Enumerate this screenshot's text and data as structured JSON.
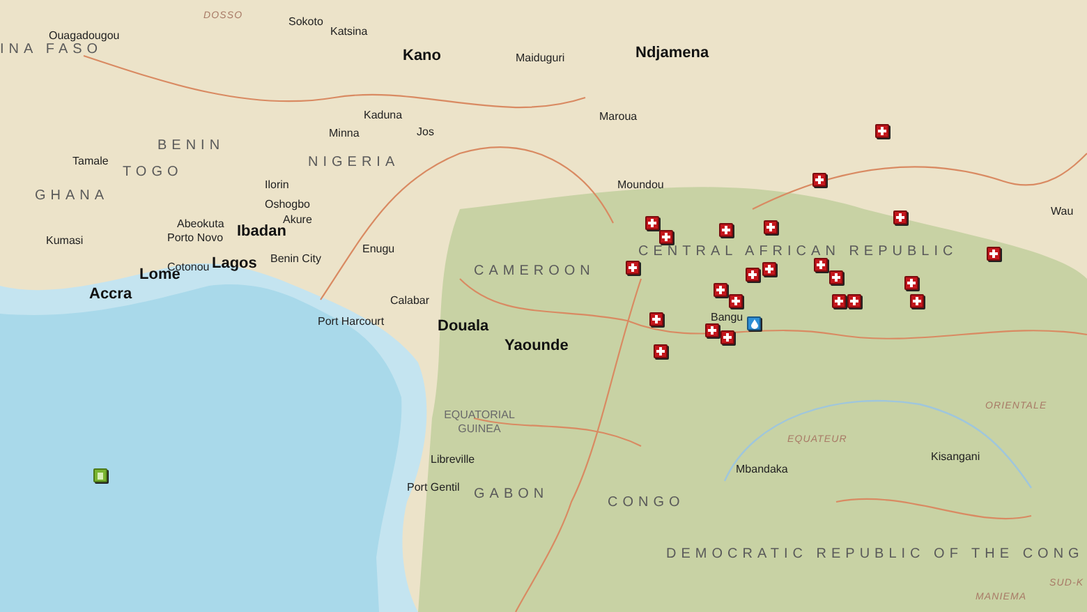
{
  "labels": [
    {
      "text": "Ouagadougou",
      "kind": "city"
    },
    {
      "text": "INA FASO",
      "kind": "country"
    },
    {
      "text": "DOSSO",
      "kind": "region"
    },
    {
      "text": "Sokoto",
      "kind": "city"
    },
    {
      "text": "Katsina",
      "kind": "city"
    },
    {
      "text": "Kano",
      "kind": "major"
    },
    {
      "text": "Maiduguri",
      "kind": "city"
    },
    {
      "text": "Ndjamena",
      "kind": "major"
    },
    {
      "text": "Maroua",
      "kind": "city"
    },
    {
      "text": "Kaduna",
      "kind": "city"
    },
    {
      "text": "Minna",
      "kind": "city"
    },
    {
      "text": "Jos",
      "kind": "city"
    },
    {
      "text": "BENIN",
      "kind": "country"
    },
    {
      "text": "NIGERIA",
      "kind": "country"
    },
    {
      "text": "Tamale",
      "kind": "city"
    },
    {
      "text": "TOGO",
      "kind": "country"
    },
    {
      "text": "GHANA",
      "kind": "country"
    },
    {
      "text": "Moundou",
      "kind": "city"
    },
    {
      "text": "Ilorin",
      "kind": "city"
    },
    {
      "text": "Oshogbo",
      "kind": "city"
    },
    {
      "text": "Abeokuta",
      "kind": "city"
    },
    {
      "text": "Ibadan",
      "kind": "major"
    },
    {
      "text": "Akure",
      "kind": "city"
    },
    {
      "text": "Wau",
      "kind": "city"
    },
    {
      "text": "Porto Novo",
      "kind": "city"
    },
    {
      "text": "Kumasi",
      "kind": "city"
    },
    {
      "text": "Benin City",
      "kind": "city"
    },
    {
      "text": "Enugu",
      "kind": "city"
    },
    {
      "text": "Cotonou",
      "kind": "city"
    },
    {
      "text": "Lagos",
      "kind": "major"
    },
    {
      "text": "Lome",
      "kind": "major"
    },
    {
      "text": "Accra",
      "kind": "major"
    },
    {
      "text": "CENTRAL AFRICAN REPUBLIC",
      "kind": "country"
    },
    {
      "text": "CAMEROON",
      "kind": "country"
    },
    {
      "text": "Calabar",
      "kind": "city"
    },
    {
      "text": "Port Harcourt",
      "kind": "city"
    },
    {
      "text": "Douala",
      "kind": "major"
    },
    {
      "text": "Bangu",
      "kind": "city"
    },
    {
      "text": "Yaounde",
      "kind": "major"
    },
    {
      "text": "ORIENTALE",
      "kind": "region"
    },
    {
      "text": "EQUATORIAL GUINEA",
      "kind": "smallcountry"
    },
    {
      "text": "EQUATEUR",
      "kind": "region"
    },
    {
      "text": "Kisangani",
      "kind": "city"
    },
    {
      "text": "Libreville",
      "kind": "city"
    },
    {
      "text": "Mbandaka",
      "kind": "city"
    },
    {
      "text": "Port Gentil",
      "kind": "city"
    },
    {
      "text": "GABON",
      "kind": "country"
    },
    {
      "text": "CONGO",
      "kind": "country"
    },
    {
      "text": "DEMOCRATIC REPUBLIC OF THE CONG",
      "kind": "country"
    },
    {
      "text": "SUD-K",
      "kind": "region"
    },
    {
      "text": "MANIEMA",
      "kind": "region"
    }
  ],
  "markers": [
    {
      "kind": "medical"
    },
    {
      "kind": "medical"
    },
    {
      "kind": "medical"
    },
    {
      "kind": "medical"
    },
    {
      "kind": "medical"
    },
    {
      "kind": "medical"
    },
    {
      "kind": "medical"
    },
    {
      "kind": "medical"
    },
    {
      "kind": "medical"
    },
    {
      "kind": "medical"
    },
    {
      "kind": "medical"
    },
    {
      "kind": "medical"
    },
    {
      "kind": "medical"
    },
    {
      "kind": "medical"
    },
    {
      "kind": "medical"
    },
    {
      "kind": "medical"
    },
    {
      "kind": "medical"
    },
    {
      "kind": "medical"
    },
    {
      "kind": "medical"
    },
    {
      "kind": "medical"
    },
    {
      "kind": "medical"
    },
    {
      "kind": "medical"
    },
    {
      "kind": "medical"
    },
    {
      "kind": "water"
    },
    {
      "kind": "supply"
    }
  ]
}
